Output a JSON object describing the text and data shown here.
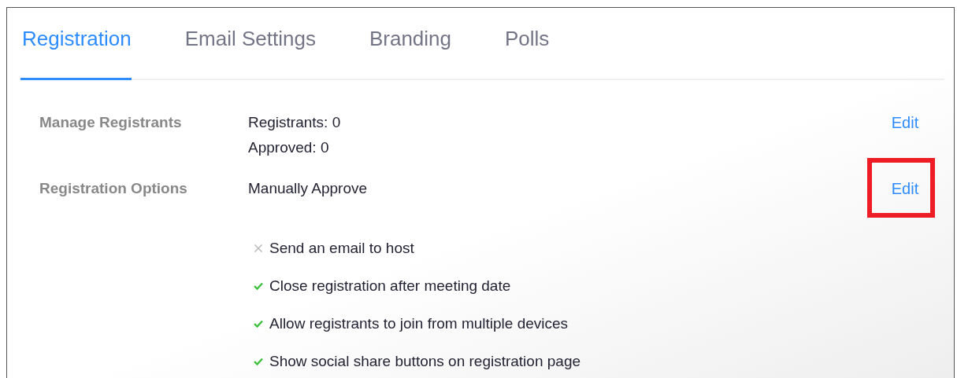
{
  "tabs": [
    {
      "label": "Registration",
      "selected": true
    },
    {
      "label": "Email Settings",
      "selected": false
    },
    {
      "label": "Branding",
      "selected": false
    },
    {
      "label": "Polls",
      "selected": false
    }
  ],
  "rows": [
    {
      "label": "Manage Registrants",
      "values": [
        "Registrants: 0",
        "Approved: 0"
      ],
      "action": "Edit",
      "highlighted": false,
      "options": []
    },
    {
      "label": "Registration Options",
      "values": [
        "Manually Approve"
      ],
      "action": "Edit",
      "highlighted": true,
      "options": [
        {
          "text": "Send an email to host",
          "checked": false
        },
        {
          "text": "Close registration after meeting date",
          "checked": true
        },
        {
          "text": "Allow registrants to join from multiple devices",
          "checked": true
        },
        {
          "text": "Show social share buttons on registration page",
          "checked": true
        }
      ]
    }
  ]
}
